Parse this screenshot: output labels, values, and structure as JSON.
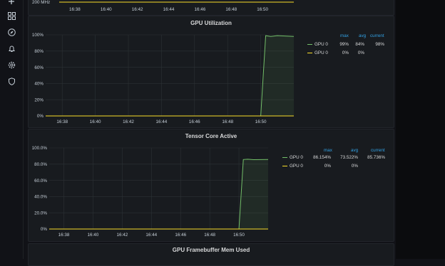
{
  "colors": {
    "gpu0_green": "#73bf69",
    "gpu0_yellow": "#fade2a",
    "axis_text": "#c7d0d9",
    "grid": "#2c3235",
    "accent": "#33a2e5"
  },
  "sidebar": {
    "icons": [
      "plus-icon",
      "dashboards-icon",
      "explore-icon",
      "alerting-icon",
      "configuration-icon",
      "shield-icon"
    ]
  },
  "top_panel": {
    "y_tick": "200 MHz",
    "x_ticks": [
      "16:38",
      "16:40",
      "16:42",
      "16:44",
      "16:46",
      "16:48",
      "16:50"
    ]
  },
  "panels": [
    {
      "title": "GPU Utilization",
      "y_ticks": [
        "100%",
        "80%",
        "60%",
        "40%",
        "20%",
        "0%"
      ],
      "x_ticks": [
        "16:38",
        "16:40",
        "16:42",
        "16:44",
        "16:46",
        "16:48",
        "16:50"
      ],
      "legend": {
        "headers": [
          "max",
          "avg",
          "current"
        ],
        "rows": [
          {
            "name": "GPU 0",
            "color": "#73bf69",
            "max": "99%",
            "avg": "84%",
            "current": "98%"
          },
          {
            "name": "GPU 0",
            "color": "#fade2a",
            "max": "0%",
            "avg": "0%",
            "current": ""
          }
        ]
      }
    },
    {
      "title": "Tensor Core Active",
      "y_ticks": [
        "100.0%",
        "80.0%",
        "60.0%",
        "40.0%",
        "20.0%",
        "0%"
      ],
      "x_ticks": [
        "16:38",
        "16:40",
        "16:42",
        "16:44",
        "16:46",
        "16:48",
        "16:50"
      ],
      "legend": {
        "headers": [
          "max",
          "avg",
          "current"
        ],
        "rows": [
          {
            "name": "GPU 0",
            "color": "#73bf69",
            "max": "86.154%",
            "avg": "73.522%",
            "current": "85.736%"
          },
          {
            "name": "GPU 0",
            "color": "#fade2a",
            "max": "0%",
            "avg": "0%",
            "current": ""
          }
        ]
      }
    },
    {
      "title": "GPU Framebuffer Mem Used"
    }
  ],
  "chart_data": [
    {
      "type": "line",
      "title": "GPU Utilization",
      "ylim": [
        0,
        100
      ],
      "x": [
        "16:37",
        "16:38",
        "16:40",
        "16:42",
        "16:44",
        "16:46",
        "16:48",
        "16:50",
        "16:50.3",
        "16:50.6",
        "16:51",
        "16:52"
      ],
      "series": [
        {
          "name": "GPU 0",
          "color": "#73bf69",
          "values": [
            0,
            0,
            0,
            0,
            0,
            0,
            0,
            0,
            99,
            98,
            99,
            98
          ]
        },
        {
          "name": "GPU 0",
          "color": "#fade2a",
          "values": [
            0,
            0,
            0,
            0,
            0,
            0,
            0,
            0,
            0,
            0,
            0,
            0
          ]
        }
      ]
    },
    {
      "type": "line",
      "title": "Tensor Core Active",
      "ylim": [
        0,
        100
      ],
      "x": [
        "16:37",
        "16:38",
        "16:40",
        "16:42",
        "16:44",
        "16:46",
        "16:48",
        "16:50",
        "16:50.3",
        "16:50.6",
        "16:51",
        "16:52"
      ],
      "series": [
        {
          "name": "GPU 0",
          "color": "#73bf69",
          "values": [
            0,
            0,
            0,
            0,
            0,
            0,
            0,
            0,
            85.7,
            86.1,
            85.5,
            85.7
          ]
        },
        {
          "name": "GPU 0",
          "color": "#fade2a",
          "values": [
            0,
            0,
            0,
            0,
            0,
            0,
            0,
            0,
            0,
            0,
            0,
            0
          ]
        }
      ]
    }
  ]
}
